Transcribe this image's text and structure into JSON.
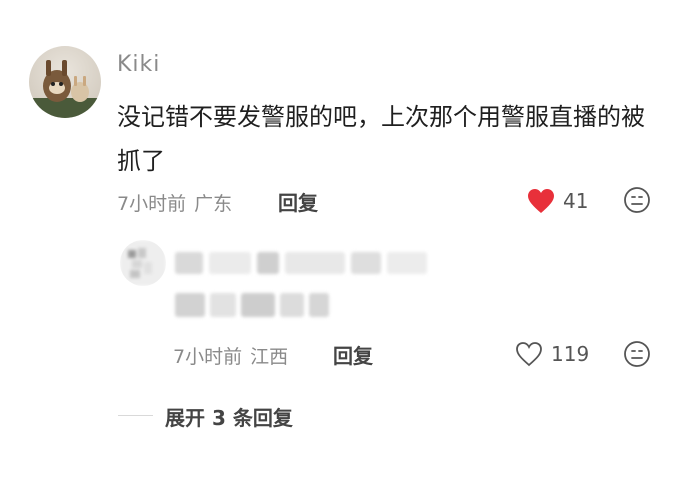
{
  "comment": {
    "username": "Kiki",
    "text": "没记错不要发警服的吧，上次那个用警服直播的被抓了",
    "time": "7小时前",
    "location": "广东",
    "reply_label": "回复",
    "likes": "41",
    "liked": true,
    "like_color": "#e8303a"
  },
  "reply": {
    "time": "7小时前",
    "location": "江西",
    "reply_label": "回复",
    "likes": "119",
    "liked": false
  },
  "expand_replies_label": "展开 3 条回复"
}
